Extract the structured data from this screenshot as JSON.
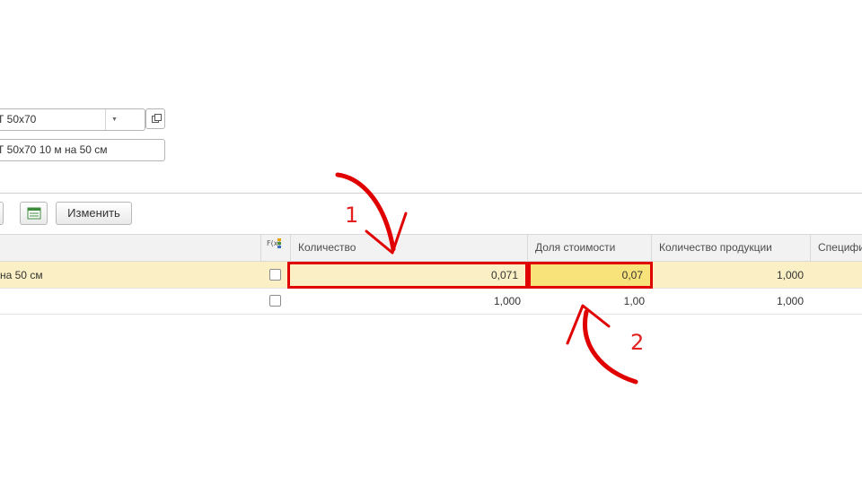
{
  "form": {
    "field1_value": "Т 50х70",
    "field2_value": "Т 50х70 10 м на 50 см"
  },
  "toolbar": {
    "change_label": "Изменить"
  },
  "table": {
    "columns": {
      "fx": "F(x)",
      "quantity": "Количество",
      "cost_share": "Доля стоимости",
      "product_quantity": "Количество продукции",
      "spec": "Специфи"
    },
    "rows": [
      {
        "name": "на 50 см",
        "quantity": "0,071",
        "cost_share": "0,07",
        "product_quantity": "1,000",
        "selected": true
      },
      {
        "name": "",
        "quantity": "1,000",
        "cost_share": "1,00",
        "product_quantity": "1,000",
        "selected": false
      }
    ]
  },
  "annotations": {
    "label1": "1",
    "label2": "2",
    "color": "#e10000"
  }
}
